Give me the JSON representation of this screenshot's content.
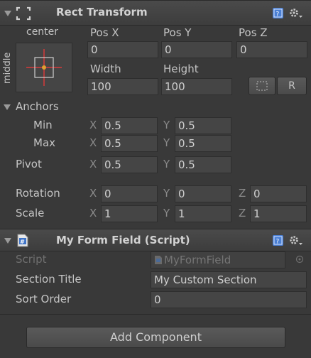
{
  "rect_transform": {
    "title": "Rect Transform",
    "anchor_preset": {
      "horizontal": "center",
      "vertical": "middle"
    },
    "pos": {
      "x_label": "Pos X",
      "y_label": "Pos Y",
      "z_label": "Pos Z",
      "x": "0",
      "y": "0",
      "z": "0"
    },
    "size": {
      "width_label": "Width",
      "height_label": "Height",
      "width": "100",
      "height": "100"
    },
    "reset_button": "R",
    "anchors": {
      "label": "Anchors",
      "min_label": "Min",
      "max_label": "Max",
      "min_x": "0.5",
      "min_y": "0.5",
      "max_x": "0.5",
      "max_y": "0.5"
    },
    "pivot": {
      "label": "Pivot",
      "x": "0.5",
      "y": "0.5"
    },
    "rotation": {
      "label": "Rotation",
      "x": "0",
      "y": "0",
      "z": "0"
    },
    "scale": {
      "label": "Scale",
      "x": "1",
      "y": "1",
      "z": "1"
    },
    "axis": {
      "x": "X",
      "y": "Y",
      "z": "Z"
    }
  },
  "script_component": {
    "title": "My Form Field (Script)",
    "script_label": "Script",
    "script_value": "MyFormField",
    "section_title_label": "Section Title",
    "section_title_value": "My Custom Section",
    "sort_order_label": "Sort Order",
    "sort_order_value": "0"
  },
  "add_component_label": "Add Component",
  "colors": {
    "background": "#393939",
    "field": "#454545",
    "help_icon": "#4a7fd4",
    "anchor_red": "#d63b3b",
    "anchor_dot": "#e0a030"
  }
}
